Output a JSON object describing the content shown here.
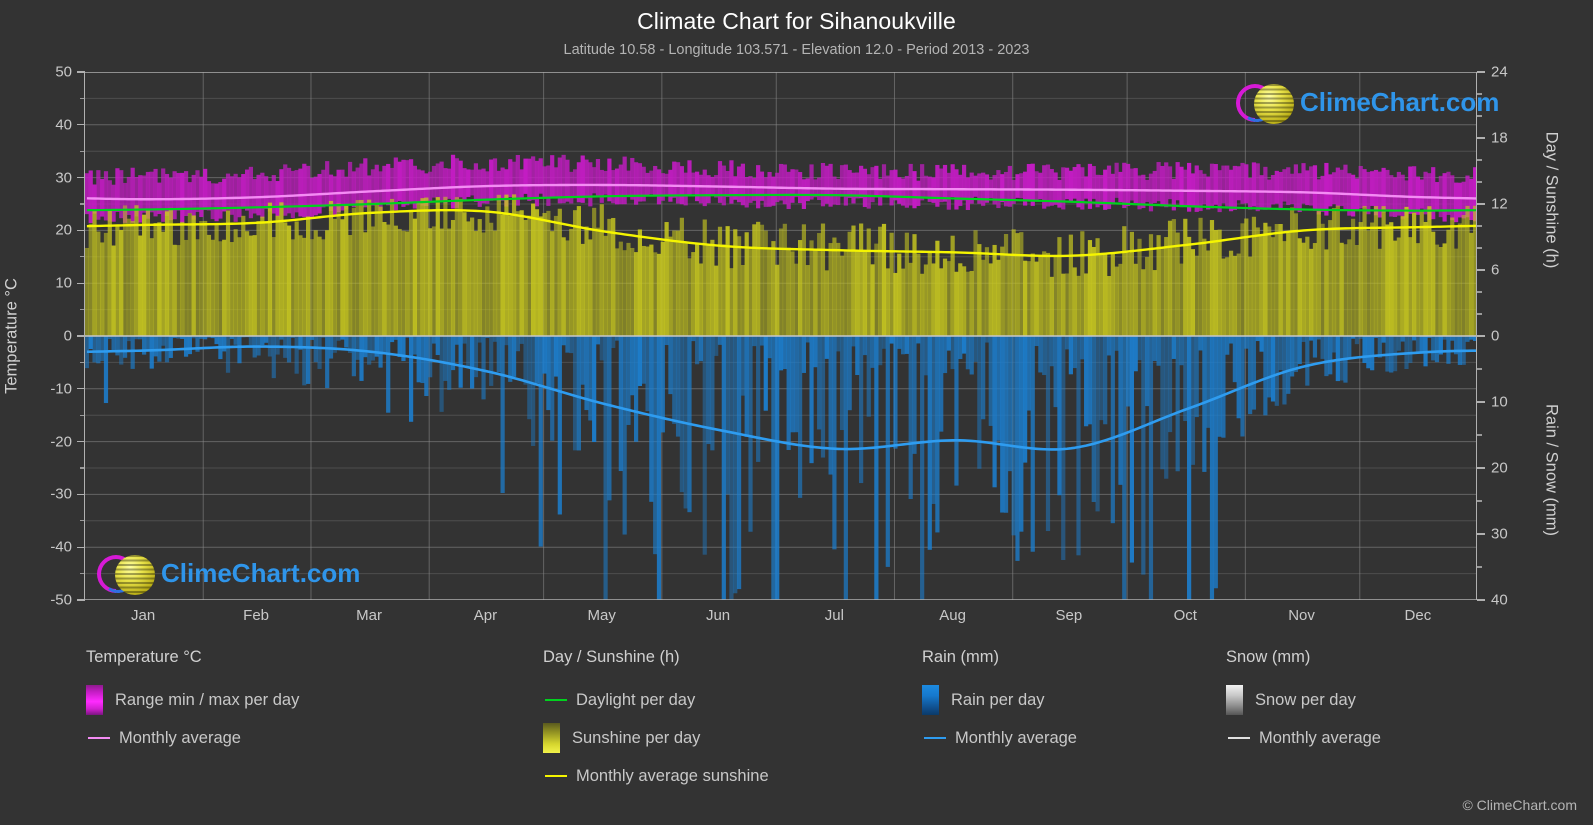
{
  "header": {
    "title": "Climate Chart for Sihanoukville",
    "subtitle": "Latitude 10.58 - Longitude 103.571 - Elevation 12.0 - Period 2013 - 2023"
  },
  "axes": {
    "left_title": "Temperature °C",
    "right_title_top": "Day / Sunshine (h)",
    "right_title_bottom": "Rain / Snow (mm)",
    "left_ticks": [
      "50",
      "40",
      "30",
      "20",
      "10",
      "0",
      "-10",
      "-20",
      "-30",
      "-40",
      "-50"
    ],
    "right_top_ticks": [
      "24",
      "18",
      "12",
      "6",
      "0"
    ],
    "right_bottom_ticks": [
      "0",
      "10",
      "20",
      "30",
      "40"
    ],
    "x_ticks": [
      "Jan",
      "Feb",
      "Mar",
      "Apr",
      "May",
      "Jun",
      "Jul",
      "Aug",
      "Sep",
      "Oct",
      "Nov",
      "Dec"
    ]
  },
  "legend": {
    "groups": [
      {
        "title": "Temperature °C",
        "entries": [
          {
            "label": "Range min / max per day",
            "kind": "swatch",
            "style": "sw-temp",
            "color": "#ff2bff"
          },
          {
            "label": "Monthly average",
            "kind": "line",
            "color": "#f48cf4"
          }
        ]
      },
      {
        "title": "Day / Sunshine (h)",
        "entries": [
          {
            "label": "Daylight per day",
            "kind": "line",
            "color": "#00d21e"
          },
          {
            "label": "Sunshine per day",
            "kind": "swatch",
            "style": "sw-sun",
            "color": "#d6d62e"
          },
          {
            "label": "Monthly average sunshine",
            "kind": "line",
            "color": "#f5f500"
          }
        ]
      },
      {
        "title": "Rain (mm)",
        "entries": [
          {
            "label": "Rain per day",
            "kind": "swatch",
            "style": "sw-rain",
            "color": "#1c8ae0"
          },
          {
            "label": "Monthly average",
            "kind": "line",
            "color": "#2e9cf0"
          }
        ]
      },
      {
        "title": "Snow (mm)",
        "entries": [
          {
            "label": "Snow per day",
            "kind": "swatch",
            "style": "sw-snow",
            "color": "#d0d0d0"
          },
          {
            "label": "Monthly average",
            "kind": "line",
            "color": "#e0e0e0"
          }
        ]
      }
    ]
  },
  "branding": {
    "wordmark": "ClimeChart.com",
    "copyright": "© ClimeChart.com"
  },
  "colors": {
    "background": "#333333",
    "gridline": "#8c8c8c",
    "axis": "#b0b0b0",
    "text": "#c8c8c8",
    "title_text": "#ffffff",
    "temp_band": "#c31cc3",
    "temp_avg_line": "#f48cf4",
    "daylight_line": "#00d21e",
    "sunshine_fill": "#a3a32b",
    "sunshine_avg_line": "#f5f500",
    "rain_fill": "#1c7fd0",
    "rain_avg_line": "#2e9cf0",
    "snow_fill": "#cccccc"
  },
  "chart_data": {
    "type": "area",
    "title": "Climate Chart for Sihanoukville",
    "subtitle": "Latitude 10.58 - Longitude 103.571 - Elevation 12.0 - Period 2013 - 2023",
    "xlabel": "",
    "ylabel": "Temperature °C",
    "ylabel_right_top": "Day / Sunshine (h)",
    "ylabel_right_bottom": "Rain / Snow (mm)",
    "ylim": [
      -50,
      50
    ],
    "ylim_right_top": [
      0,
      24
    ],
    "ylim_right_bottom": [
      0,
      40
    ],
    "grid": true,
    "legend_position": "below",
    "categories": [
      "Jan",
      "Feb",
      "Mar",
      "Apr",
      "May",
      "Jun",
      "Jul",
      "Aug",
      "Sep",
      "Oct",
      "Nov",
      "Dec"
    ],
    "series": [
      {
        "name": "Monthly average temperature",
        "unit": "°C",
        "axis": "left",
        "color": "#f48cf4",
        "values": [
          25.9,
          26.3,
          27.4,
          28.4,
          28.6,
          28.3,
          27.9,
          27.8,
          27.7,
          27.5,
          27.2,
          26.3
        ]
      },
      {
        "name": "Daily max temperature (band top)",
        "unit": "°C",
        "axis": "left",
        "color": "#c31cc3",
        "values": [
          30.0,
          30.6,
          31.8,
          32.5,
          32.4,
          31.5,
          31.0,
          30.8,
          30.9,
          31.0,
          31.0,
          30.3
        ]
      },
      {
        "name": "Daily min temperature (band bottom)",
        "unit": "°C",
        "axis": "left",
        "color": "#c31cc3",
        "values": [
          22.5,
          23.0,
          24.3,
          25.5,
          25.8,
          25.5,
          25.2,
          25.1,
          25.0,
          24.8,
          24.2,
          23.0
        ]
      },
      {
        "name": "Daylight per day",
        "unit": "h",
        "axis": "right_top",
        "color": "#00d21e",
        "values": [
          11.5,
          11.7,
          12.0,
          12.4,
          12.7,
          12.8,
          12.8,
          12.5,
          12.2,
          11.8,
          11.5,
          11.4
        ]
      },
      {
        "name": "Monthly average sunshine",
        "unit": "h",
        "axis": "right_top",
        "color": "#f5f500",
        "values": [
          10.1,
          10.3,
          11.2,
          11.3,
          9.5,
          8.2,
          7.8,
          7.6,
          7.3,
          8.3,
          9.6,
          9.9
        ]
      },
      {
        "name": "Monthly average rain",
        "unit": "mm",
        "axis": "right_bottom",
        "color": "#2e9cf0",
        "values": [
          2.2,
          1.6,
          2.4,
          5.4,
          10.3,
          14.3,
          17.1,
          15.8,
          17.0,
          11.0,
          4.6,
          2.5
        ]
      },
      {
        "name": "Monthly average snow",
        "unit": "mm",
        "axis": "right_bottom",
        "color": "#e0e0e0",
        "values": [
          0,
          0,
          0,
          0,
          0,
          0,
          0,
          0,
          0,
          0,
          0,
          0
        ]
      }
    ]
  }
}
